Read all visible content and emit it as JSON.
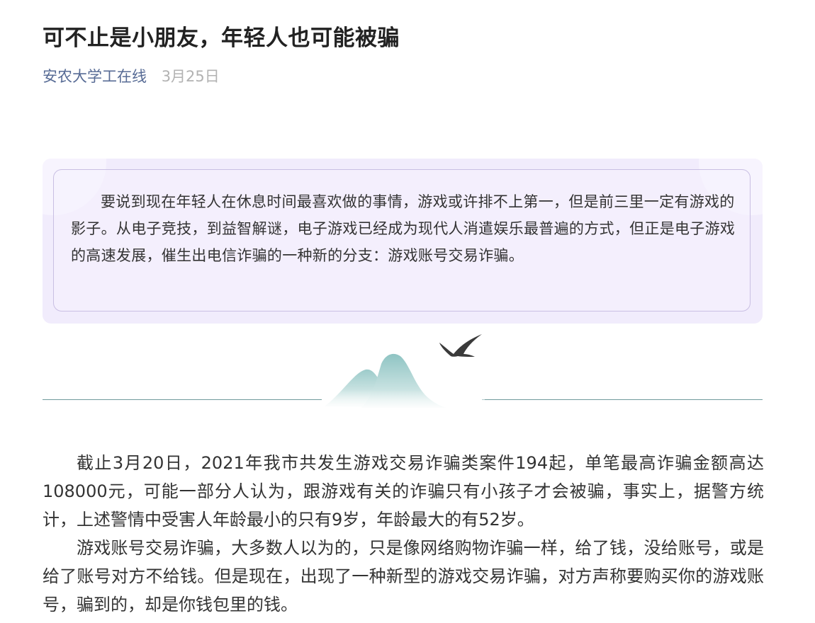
{
  "article": {
    "title": "可不止是小朋友，年轻人也可能被骗",
    "account_name": "安农大学工在线",
    "publish_date": "3月25日"
  },
  "intro": {
    "text": "要说到现在年轻人在休息时间最喜欢做的事情，游戏或许排不上第一，但是前三里一定有游戏的影子。从电子竞技，到益智解谜，电子游戏已经成为现代人消遣娱乐最普遍的方式，但正是电子游戏的高速发展，催生出电信诈骗的一种新的分支：游戏账号交易诈骗。"
  },
  "body": {
    "paragraphs": [
      "截止3月20日，2021年我市共发生游戏交易诈骗类案件194起，单笔最高诈骗金额高达108000元，可能一部分人认为，跟游戏有关的诈骗只有小孩子才会被骗，事实上，据警方统计，上述警情中受害人年龄最小的只有9岁，年龄最大的有52岁。",
      "游戏账号交易诈骗，大多数人以为的，只是像网络购物诈骗一样，给了钱，没给账号，或是给了账号对方不给钱。但是现在，出现了一种新型的游戏交易诈骗，对方声称要购买你的游戏账号，骗到的，却是你钱包里的钱。"
    ]
  },
  "decor": {
    "divider_icon": "swallow-over-mountains-icon",
    "card_color": "#f1ecfc",
    "card_border_color": "#c9bfe3",
    "account_color": "#576b95",
    "divider_color": "#6f9a9c"
  }
}
